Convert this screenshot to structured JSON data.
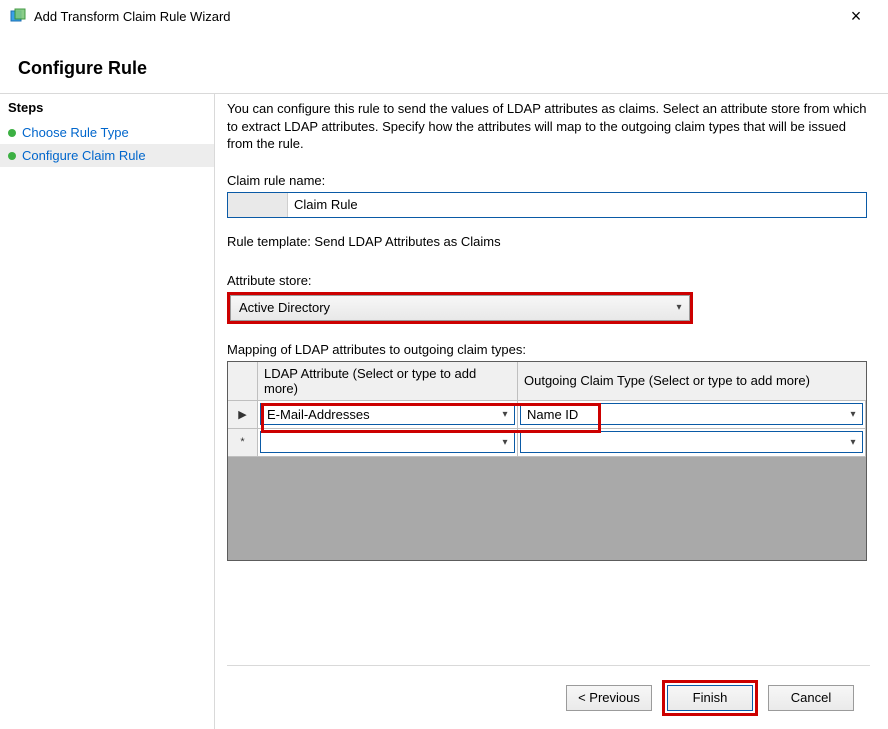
{
  "window": {
    "title": "Add Transform Claim Rule Wizard"
  },
  "heading": "Configure Rule",
  "sidebar": {
    "title": "Steps",
    "items": [
      {
        "label": "Choose Rule Type"
      },
      {
        "label": "Configure Claim Rule"
      }
    ]
  },
  "desc": "You can configure this rule to send the values of LDAP attributes as claims. Select an attribute store from which to extract LDAP attributes. Specify how the attributes will map to the outgoing claim types that will be issued from the rule.",
  "labels": {
    "ruleName": "Claim rule name:",
    "template": "Rule template: Send LDAP Attributes as Claims",
    "store": "Attribute store:",
    "mapping": "Mapping of LDAP attributes to outgoing claim types:"
  },
  "rule": {
    "name": "Claim Rule",
    "store": "Active Directory"
  },
  "grid": {
    "head": {
      "ldap": "LDAP Attribute (Select or type to add more)",
      "claim": "Outgoing Claim Type (Select or type to add more)"
    },
    "rows": [
      {
        "marker": "▶",
        "ldap": "E-Mail-Addresses",
        "claim": "Name ID"
      },
      {
        "marker": "*",
        "ldap": "",
        "claim": ""
      }
    ]
  },
  "footer": {
    "previous": "< Previous",
    "finish": "Finish",
    "cancel": "Cancel"
  }
}
